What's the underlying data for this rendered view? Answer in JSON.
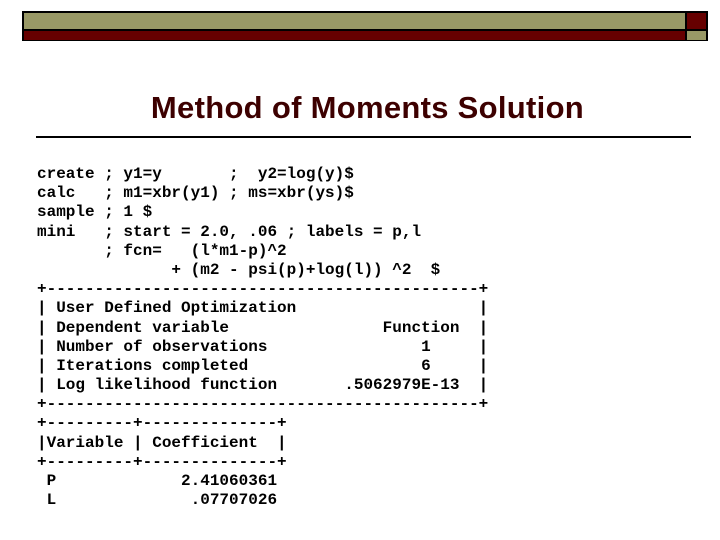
{
  "colors": {
    "olive": "#999966",
    "dark_red": "#660000",
    "title_color": "#3d0000",
    "frame": "#000000"
  },
  "slide": {
    "title": "Method of Moments Solution"
  },
  "commands": [
    "create ; y1=y       ;  y2=log(y)$",
    "calc   ; m1=xbr(y1) ; ms=xbr(ys)$",
    "sample ; 1 $",
    "mini   ; start = 2.0, .06 ; labels = p,l",
    "       ; fcn=   (l*m1-p)^2",
    "              + (m2 - psi(p)+log(l)) ^2  $"
  ],
  "summary_box": {
    "border_top": "+---------------------------------------------+",
    "rows": [
      {
        "label": "User Defined Optimization",
        "value": ""
      },
      {
        "label": "Dependent variable",
        "value": "Function"
      },
      {
        "label": "Number of observations",
        "value": "1"
      },
      {
        "label": "Iterations completed",
        "value": "6"
      },
      {
        "label": "Log likelihood function",
        "value": ".5062979E-13"
      }
    ],
    "lines": [
      "| User Defined Optimization                   |",
      "| Dependent variable                Function  |",
      "| Number of observations                1     |",
      "| Iterations completed                  6     |",
      "| Log likelihood function       .5062979E-13  |"
    ],
    "border_bottom": "+---------------------------------------------+"
  },
  "coef_table": {
    "border_top": "+---------+--------------+",
    "header_line": "|Variable | Coefficient  |",
    "headers": [
      "Variable",
      "Coefficient"
    ],
    "border_mid": "+---------+--------------+",
    "rows": [
      {
        "variable": "P",
        "coefficient": "2.41060361"
      },
      {
        "variable": "L",
        "coefficient": ".07707026"
      }
    ],
    "row_lines": [
      " P             2.41060361",
      " L              .07707026"
    ]
  }
}
